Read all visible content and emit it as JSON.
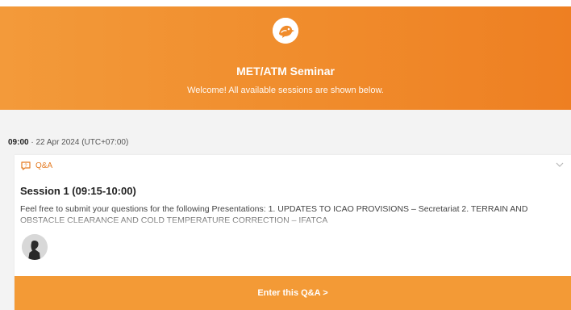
{
  "header": {
    "title": "MET/ATM Seminar",
    "subtitle": "Welcome! All available sessions are shown below."
  },
  "session": {
    "time": "09:00",
    "separator": "·",
    "date": "22 Apr 2024 (UTC+07:00)"
  },
  "card": {
    "type_label": "Q&A",
    "title": "Session 1 (09:15-10:00)",
    "description": "Feel free to submit your questions for the following Presentations: 1. UPDATES TO ICAO PROVISIONS – Secretariat 2. TERRAIN AND OBSTACLE CLEARANCE AND COLD TEMPERATURE CORRECTION – IFATCA",
    "button_label": "Enter this Q&A >"
  },
  "colors": {
    "accent": "#f08c2c",
    "button": "#f39a36"
  },
  "icons": [
    "bird-logo-icon",
    "qa-icon",
    "chevron-down-icon",
    "avatar-icon"
  ]
}
